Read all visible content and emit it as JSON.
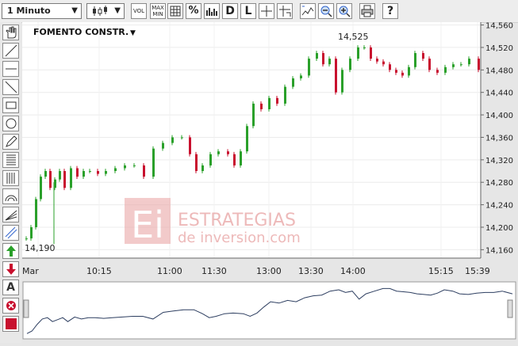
{
  "toolbar": {
    "interval_label": "1 Minuto",
    "vol_label": "VOL",
    "maxmin_label": "MAX MIN",
    "percent_label": "%",
    "d_label": "D",
    "l_label": "L",
    "help_label": "?"
  },
  "sidebar": {
    "a_label": "A"
  },
  "watermark": {
    "logo_text": "Ei",
    "line1": "ESTRATEGIAS",
    "line2": "de inversion.com"
  },
  "chart_data": {
    "type": "candlestick",
    "title": "FOMENTO CONSTR.",
    "title_arrow": "▼",
    "ylim": [
      14.145,
      14.565
    ],
    "y_ticks": [
      "14,560",
      "14,520",
      "14,480",
      "14,440",
      "14,400",
      "14,360",
      "14,320",
      "14,280",
      "14,240",
      "14,200",
      "14,160"
    ],
    "y_tick_values": [
      14.56,
      14.52,
      14.48,
      14.44,
      14.4,
      14.36,
      14.32,
      14.28,
      14.24,
      14.2,
      14.16
    ],
    "x_ticks": [
      "Mar",
      "10:15",
      "11:00",
      "11:30",
      "13:00",
      "13:30",
      "14:00",
      "15:15",
      "15:39"
    ],
    "annotations": {
      "high": "14,525",
      "low": "14,190"
    },
    "colors": {
      "up": "#2aa02a",
      "down": "#c8102e",
      "overview_line": "#2d3e60"
    }
  }
}
